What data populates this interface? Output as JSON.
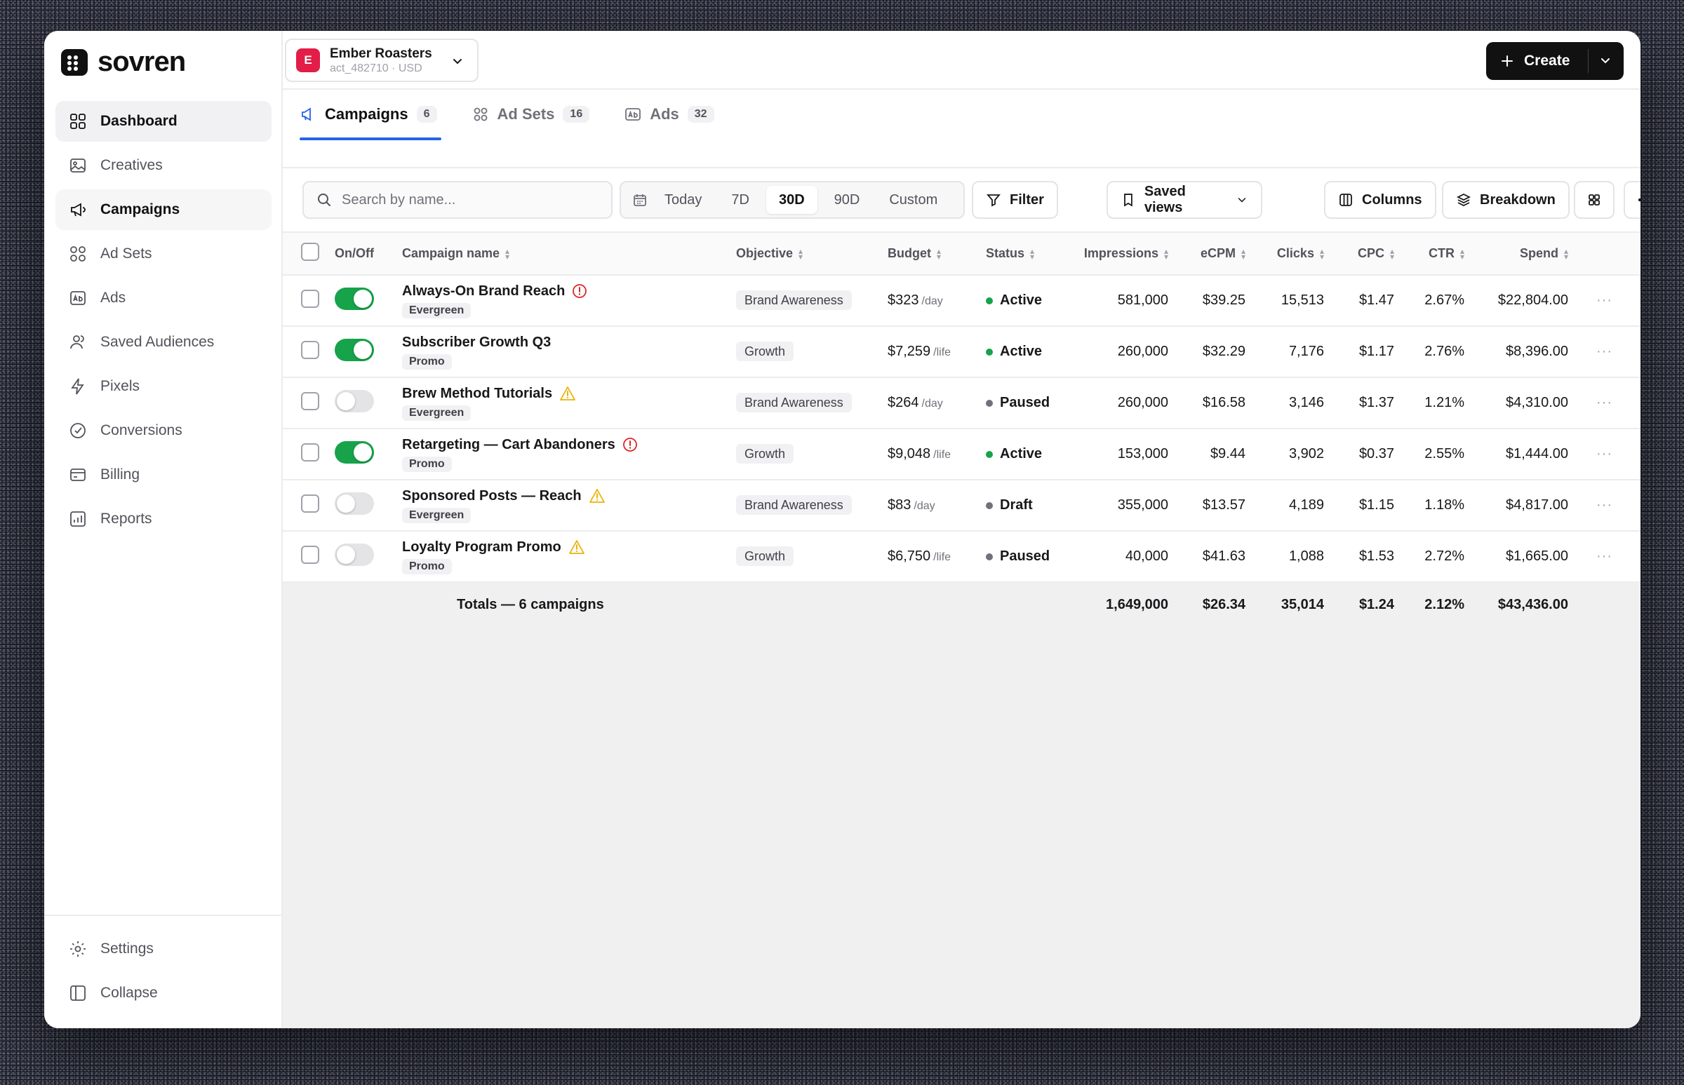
{
  "brand": {
    "name": "sovren"
  },
  "account": {
    "initial": "E",
    "name": "Ember Roasters",
    "sub": "act_482710 · USD"
  },
  "create_label": "Create",
  "sidebar": {
    "items": [
      {
        "label": "Dashboard",
        "icon": "dashboard-icon"
      },
      {
        "label": "Creatives",
        "icon": "image-icon"
      },
      {
        "label": "Campaigns",
        "icon": "megaphone-icon"
      },
      {
        "label": "Ad Sets",
        "icon": "grid-icon"
      },
      {
        "label": "Ads",
        "icon": "ad-icon"
      },
      {
        "label": "Saved Audiences",
        "icon": "users-icon"
      },
      {
        "label": "Pixels",
        "icon": "bolt-icon"
      },
      {
        "label": "Conversions",
        "icon": "target-icon"
      },
      {
        "label": "Billing",
        "icon": "card-icon"
      },
      {
        "label": "Reports",
        "icon": "report-icon"
      }
    ],
    "bottom": [
      {
        "label": "Settings",
        "icon": "gear-icon"
      },
      {
        "label": "Collapse",
        "icon": "collapse-icon"
      }
    ]
  },
  "tabs": [
    {
      "label": "Campaigns",
      "count": "6"
    },
    {
      "label": "Ad Sets",
      "count": "16"
    },
    {
      "label": "Ads",
      "count": "32"
    }
  ],
  "toolbar": {
    "search_placeholder": "Search by name...",
    "ranges": [
      "Today",
      "7D",
      "30D",
      "90D",
      "Custom"
    ],
    "active_range": "30D",
    "filter_label": "Filter",
    "saved_views_label": "Saved views",
    "columns_label": "Columns",
    "breakdown_label": "Breakdown"
  },
  "table": {
    "headers": {
      "onoff": "On/Off",
      "name": "Campaign name",
      "objective": "Objective",
      "budget": "Budget",
      "status": "Status",
      "impressions": "Impressions",
      "ecpm": "eCPM",
      "clicks": "Clicks",
      "cpc": "CPC",
      "ctr": "CTR",
      "spend": "Spend"
    },
    "rows": [
      {
        "on": true,
        "name": "Always-On Brand Reach",
        "alert": "error",
        "tag": "Evergreen",
        "objective": "Brand Awareness",
        "budget": "$323",
        "unit": "/day",
        "status": "Active",
        "impressions": "581,000",
        "ecpm": "$39.25",
        "clicks": "15,513",
        "cpc": "$1.47",
        "ctr": "2.67%",
        "spend": "$22,804.00"
      },
      {
        "on": true,
        "name": "Subscriber Growth Q3",
        "alert": "",
        "tag": "Promo",
        "objective": "Growth",
        "budget": "$7,259",
        "unit": "/life",
        "status": "Active",
        "impressions": "260,000",
        "ecpm": "$32.29",
        "clicks": "7,176",
        "cpc": "$1.17",
        "ctr": "2.76%",
        "spend": "$8,396.00"
      },
      {
        "on": false,
        "name": "Brew Method Tutorials",
        "alert": "warning",
        "tag": "Evergreen",
        "objective": "Brand Awareness",
        "budget": "$264",
        "unit": "/day",
        "status": "Paused",
        "impressions": "260,000",
        "ecpm": "$16.58",
        "clicks": "3,146",
        "cpc": "$1.37",
        "ctr": "1.21%",
        "spend": "$4,310.00"
      },
      {
        "on": true,
        "name": "Retargeting — Cart Abandoners",
        "alert": "error",
        "tag": "Promo",
        "objective": "Growth",
        "budget": "$9,048",
        "unit": "/life",
        "status": "Active",
        "impressions": "153,000",
        "ecpm": "$9.44",
        "clicks": "3,902",
        "cpc": "$0.37",
        "ctr": "2.55%",
        "spend": "$1,444.00"
      },
      {
        "on": false,
        "name": "Sponsored Posts — Reach",
        "alert": "warning",
        "tag": "Evergreen",
        "objective": "Brand Awareness",
        "budget": "$83",
        "unit": "/day",
        "status": "Draft",
        "impressions": "355,000",
        "ecpm": "$13.57",
        "clicks": "4,189",
        "cpc": "$1.15",
        "ctr": "1.18%",
        "spend": "$4,817.00"
      },
      {
        "on": false,
        "name": "Loyalty Program Promo",
        "alert": "warning",
        "tag": "Promo",
        "objective": "Growth",
        "budget": "$6,750",
        "unit": "/life",
        "status": "Paused",
        "impressions": "40,000",
        "ecpm": "$41.63",
        "clicks": "1,088",
        "cpc": "$1.53",
        "ctr": "2.72%",
        "spend": "$1,665.00"
      }
    ],
    "totals": {
      "label": "Totals — 6 campaigns",
      "impressions": "1,649,000",
      "ecpm": "$26.34",
      "clicks": "35,014",
      "cpc": "$1.24",
      "ctr": "2.12%",
      "spend": "$43,436.00"
    }
  },
  "colors": {
    "active": "#16a34a",
    "inactive": "#71717a",
    "accent": "#2563eb",
    "error": "#dc2626",
    "warning": "#eab308"
  }
}
